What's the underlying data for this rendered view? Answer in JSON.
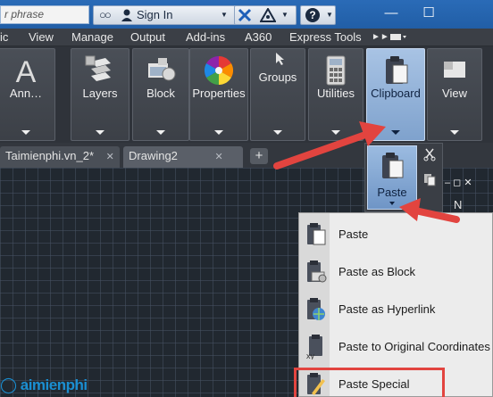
{
  "title_bar": {
    "search_placeholder": "r phrase",
    "sign_in": "Sign In",
    "help_label": "?",
    "window_minimize": "—",
    "window_maximize": "☐"
  },
  "menu": {
    "items": [
      "ic",
      "View",
      "Manage",
      "Output",
      "Add-ins",
      "A360",
      "Express Tools"
    ]
  },
  "ribbon": {
    "panels": [
      {
        "label": "Ann…",
        "icon": "text-icon"
      },
      {
        "label": "Layers",
        "icon": "layers-icon"
      },
      {
        "label": "Block",
        "icon": "block-icon"
      },
      {
        "label": "Properties",
        "icon": "color-wheel-icon"
      },
      {
        "label": "Groups",
        "icon": "groups-icon"
      },
      {
        "label": "Utilities",
        "icon": "calculator-icon"
      },
      {
        "label": "Clipboard",
        "icon": "clipboard-icon"
      },
      {
        "label": "View",
        "icon": "view-icon"
      }
    ],
    "active_panel": "Clipboard"
  },
  "tabs": {
    "items": [
      {
        "label": "Taimienphi.vn_2*",
        "close": "✕"
      },
      {
        "label": "Drawing2",
        "close": "✕"
      }
    ],
    "active": "Drawing2",
    "add_label": "+"
  },
  "flyout": {
    "paste_label": "Paste"
  },
  "viewcube": {
    "controls": "– ◻ ✕",
    "compass_label": "N"
  },
  "paste_menu": {
    "items": [
      {
        "label": "Paste",
        "icon": "paste-icon"
      },
      {
        "label": "Paste as Block",
        "icon": "paste-block-icon"
      },
      {
        "label": "Paste as Hyperlink",
        "icon": "paste-hyperlink-icon"
      },
      {
        "label": "Paste to Original Coordinates",
        "icon": "paste-coordinates-icon"
      },
      {
        "label": "Paste Special",
        "icon": "paste-special-icon"
      }
    ],
    "highlighted": "Paste Special"
  },
  "watermark": "Taimienphi",
  "colors": {
    "accent": "#2a6bb7",
    "active_panel": "#8fb0d8",
    "annotation_red": "#e2443f",
    "canvas": "#212830"
  }
}
